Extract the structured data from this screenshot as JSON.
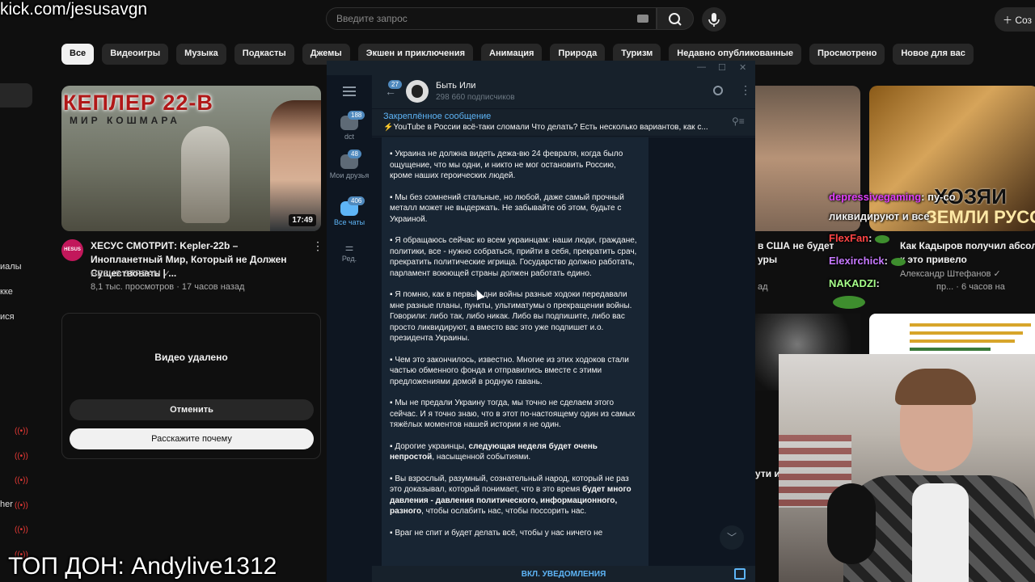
{
  "overlay": {
    "kick_url": "kick.com/jesusavgn",
    "top_donation": "ТОП ДОН: Andylive1312"
  },
  "youtube": {
    "search_placeholder": "Введите запрос",
    "create_label": "Соз",
    "chips": [
      "Все",
      "Видеоигры",
      "Музыка",
      "Подкасты",
      "Джемы",
      "Экшен и приключения",
      "Анимация",
      "Природа",
      "Туризм",
      "Недавно опубликованные",
      "Просмотрено",
      "Новое для вас"
    ],
    "sidebar_fragments": [
      "иалы",
      "кке",
      "ися",
      "her"
    ],
    "video1": {
      "thumb_title": "КЕПЛЕР 22-В",
      "thumb_subtitle": "МИР КОШМАРА",
      "duration": "17:49",
      "title": "ХЕСУС СМОТРИТ: Kepler-22b – Инопланетный Мир, Который не Должен Существовать | ...",
      "channel": "HESUS STREAM ✓",
      "meta": "8,1 тыс. просмотров · 17 часов назад",
      "avatar_text": "HESUS"
    },
    "removed": {
      "title": "Видео удалено",
      "undo": "Отменить",
      "why": "Расскажите почему"
    },
    "right": {
      "thumb3_line1": "ХОЗЯИ",
      "thumb3_line2": "ЗЕМЛИ РУСС",
      "title_a": "в США не будет",
      "title_a2": "уры",
      "meta_a": "ад",
      "title_b": "Как Кадыров получил абсол",
      "title_b2": "к это привело",
      "meta_b1": "Александр Штефанов ✓",
      "meta_b2": "пр... · 6 часов на",
      "title_c": "ути и"
    }
  },
  "chat_overlay": [
    {
      "user": "depressivegaming",
      "text": ": пу-со",
      "color": "#e040fb"
    },
    {
      "user": "",
      "text": "ликвидируют и все",
      "color": "#ffffff"
    },
    {
      "user": "FlexFan",
      "text": ":",
      "color": "#ff4444"
    },
    {
      "user": "Elexirchick",
      "text": ":",
      "color": "#c779ff"
    },
    {
      "user": "NAKADZI",
      "text": ":",
      "color": "#a7ff8a"
    }
  ],
  "telegram": {
    "folders": [
      {
        "label": "dct",
        "badge": "188"
      },
      {
        "label": "Мои друзья",
        "badge": "48"
      },
      {
        "label": "Все чаты",
        "badge": "406"
      },
      {
        "label": "Ред.",
        "badge": ""
      }
    ],
    "back_badge": "27",
    "channel_name": "Быть Или",
    "subscribers": "298 660 подписчиков",
    "pinned_title": "Закреплённое сообщение",
    "pinned_text": "⚡YouTube в России всё-таки сломали  Что делать? Есть несколько вариантов, как с...",
    "message": [
      "▪ Украина не должна видеть дежа-вю 24 февраля, когда было ощущение, что мы одни, и никто не мог остановить Россию, кроме наших героических людей.",
      "▪ Мы без сомнений стальные, но любой, даже самый прочный металл может не выдержать. Не забывайте об этом, будьте с Украиной.",
      "▪ Я обращаюсь сейчас ко всем украинцам: наши люди, граждане, политики, все - нужно собраться, прийти в себя, прекратить срач, прекратить политические игрища. Государство должно работать, парламент воюющей страны должен работать едино.",
      "▪ Я помню, как в первые дни войны разные ходоки передавали мне разные планы, пункты, ультиматумы о прекращении войны. Говорили: либо так, либо никак. Либо вы подпишите, либо вас просто ликвидируют, а вместо вас это уже подпишет и.о. президента Украины.",
      "▪ Чем это закончилось, известно. Многие из этих ходоков стали частью обменного фонда и отправились вместе с этими предложениями домой в родную гавань.",
      "▪ Мы не предали Украину тогда, мы точно не сделаем этого сейчас. И я точно знаю, что в этот по-настоящему один из самых тяжёлых моментов нашей истории я не один."
    ],
    "msg7_a": "▪ Дорогие украинцы, ",
    "msg7_b": "следующая неделя будет очень непростой",
    "msg7_c": ", насыщенной событиями.",
    "msg8_a": "▪ Вы взрослый, разумный, сознательный народ, который не раз это доказывал, который понимает, что в это время ",
    "msg8_b": "будет много давления - давления политического, информационного, разного",
    "msg8_c": ", чтобы ослабить нас, чтобы поссорить нас.",
    "msg9": "▪ Враг не спит и будет делать всё, чтобы у нас ничего не",
    "notif_button": "ВКЛ. УВЕДОМЛЕНИЯ"
  }
}
